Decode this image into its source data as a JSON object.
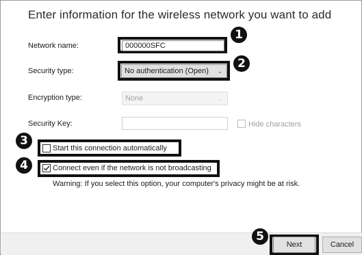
{
  "dialog": {
    "heading": "Enter information for the wireless network you want to add"
  },
  "form": {
    "network_name": {
      "label": "Network name:",
      "value": "000000SFC"
    },
    "security_type": {
      "label": "Security type:",
      "value": "No authentication (Open)"
    },
    "encryption_type": {
      "label": "Encryption type:",
      "value": "None"
    },
    "security_key": {
      "label": "Security Key:",
      "value": "",
      "hide_label": "Hide characters",
      "hide_checked": false
    },
    "auto_start": {
      "label": "Start this connection automatically",
      "checked": false
    },
    "connect_hidden": {
      "label": "Connect even if the network is not broadcasting",
      "checked": true
    },
    "warning": "Warning: If you select this option, your computer's privacy might be at risk."
  },
  "buttons": {
    "next": "Next",
    "cancel": "Cancel"
  },
  "callouts": [
    "1",
    "2",
    "3",
    "4",
    "5"
  ],
  "icons": {
    "dropdown": "chevron-down-icon",
    "check": "checkmark-icon"
  },
  "colors": {
    "disabled_text": "#a0a0a0",
    "callout": "#111111",
    "footer_bg": "#f0f0f0"
  }
}
